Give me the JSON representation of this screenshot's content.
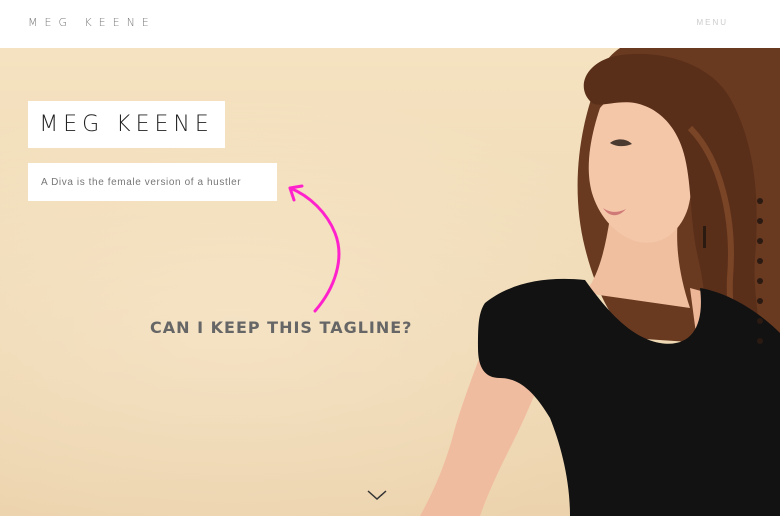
{
  "header": {
    "brand": "MEG KEENE",
    "menu_label": "MENU"
  },
  "hero": {
    "title": "MEG KEENE",
    "tagline": "A Diva is the female version of a hustler",
    "annotation": "CAN I KEEP THIS TAGLINE?"
  },
  "icons": {
    "arrow": "curved-arrow-icon",
    "scroll": "chevron-down-icon"
  },
  "colors": {
    "annotation_arrow": "#ff22cc",
    "wall": "#f1dcb8",
    "dress": "#111111",
    "hair": "#5a2f1a"
  }
}
